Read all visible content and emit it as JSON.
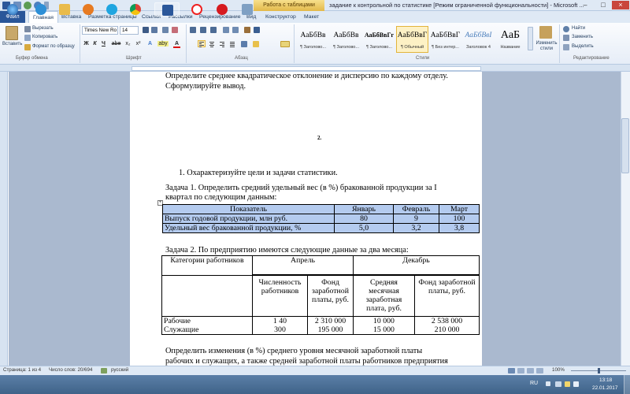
{
  "window": {
    "context_tab": "Работа с таблицами",
    "title": "задание к контрольной по статистике [Режим ограниченной функциональности] - Microsoft ...",
    "controls": [
      "–",
      "□",
      "×"
    ]
  },
  "tabs": [
    "Файл",
    "Главная",
    "Вставка",
    "Разметка страницы",
    "Ссылки",
    "Рассылки",
    "Рецензирование",
    "Вид",
    "Конструктор",
    "Макет"
  ],
  "ribbon": {
    "clipboard": {
      "paste": "Вставить",
      "cut": "Вырезать",
      "copy": "Копировать",
      "format_painter": "Формат по образцу",
      "label": "Буфер обмена"
    },
    "font": {
      "name": "Times New Ro",
      "size": "14",
      "label": "Шрифт",
      "format_buttons": [
        "Ж",
        "К",
        "Ч",
        "abe",
        "x₂",
        "x²",
        "A",
        "aby",
        "A"
      ]
    },
    "paragraph": {
      "label": "Абзац"
    },
    "styles": {
      "items": [
        {
          "preview": "АаБбВв",
          "name": "¶ Заголово..."
        },
        {
          "preview": "АаБбВв",
          "name": "¶ Заголово..."
        },
        {
          "preview": "АаБбВвГг",
          "name": "¶ Заголово..."
        },
        {
          "preview": "АаБбВвГ",
          "name": "¶ Обычный"
        },
        {
          "preview": "АаБбВвГ",
          "name": "¶ Без интер..."
        },
        {
          "preview": "АаБбВвI",
          "name": "Заголовок 4"
        },
        {
          "preview": "АаБ",
          "name": "Название"
        }
      ],
      "change_styles": "Изменить стили",
      "label": "Стили"
    },
    "editing": {
      "find": "Найти",
      "replace": "Заменить",
      "select": "Выделить",
      "label": "Редактирование"
    }
  },
  "document": {
    "line1": "Определите среднее квадратическое отклонение и дисперсию по каждому отделу.",
    "line2": "Сформулируйте вывод.",
    "section_number": "2.",
    "item1": "1.   Охарактеризуйте цели и задачи статистики.",
    "task1_line1": "Задача 1. Определить средний удельный вес (в %) бракованной продукции за I",
    "task1_line2": "квартал по следующим данным:",
    "table1": {
      "headers": [
        "Показатель",
        "Январь",
        "Февраль",
        "Март"
      ],
      "rows": [
        [
          "Выпуск годовой продукции, млн руб.",
          "80",
          "9",
          "100"
        ],
        [
          "Удельный вес бракованной продукции, %",
          "5,0",
          "3,2",
          "3,8"
        ]
      ]
    },
    "task2": "Задача 2. По предприятию имеются следующие данные за два месяца:",
    "table2": {
      "col_category": "Категории работников",
      "april": "Апрель",
      "december": "Декабрь",
      "sub_headers": [
        "Численность работников",
        "Фонд заработной платы, руб.",
        "Средняя месячная заработная плата, руб.",
        "Фонд заработной платы, руб."
      ],
      "rows": [
        [
          "Рабочие",
          "1 40",
          "2 310 000",
          "10 000",
          "2 538 000"
        ],
        [
          "Служащие",
          "300",
          "195 000",
          "15 000",
          "210 000"
        ]
      ]
    },
    "para1": "Определить изменения  (в %) среднего уровня месячной заработной платы",
    "para2": "рабочих и служащих, а также средней заработной платы работников предприятия"
  },
  "status": {
    "page": "Страница: 1 из 4",
    "words": "Число слов: 20/694",
    "language": "русский",
    "zoom": "100%"
  },
  "taskbar": {
    "lang": "RU",
    "time": "13:18",
    "date": "22.01.2017"
  },
  "colors": {
    "accent": "#2a5699",
    "selection": "#b4cbef",
    "close": "#c9463d"
  }
}
